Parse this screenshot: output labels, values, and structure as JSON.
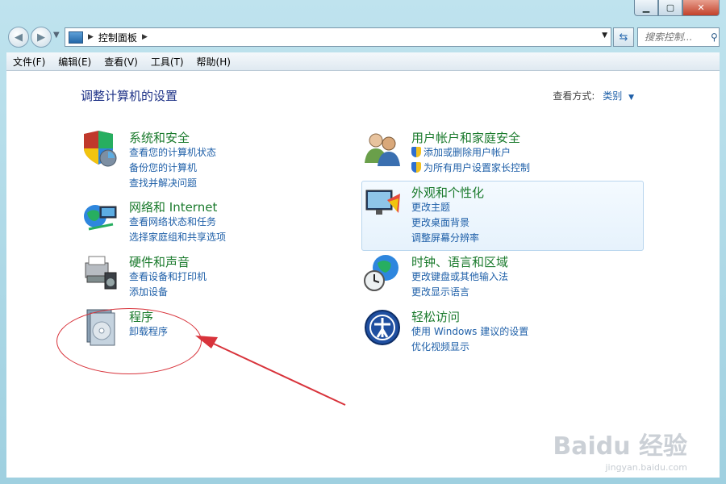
{
  "address": {
    "path": "控制面板"
  },
  "search": {
    "placeholder": "搜索控制..."
  },
  "menu": {
    "file": "文件(F)",
    "edit": "编辑(E)",
    "view": "查看(V)",
    "tools": "工具(T)",
    "help": "帮助(H)"
  },
  "page": {
    "title": "调整计算机的设置",
    "view_by_label": "查看方式:",
    "view_by_value": "类别"
  },
  "left": [
    {
      "title": "系统和安全",
      "links": [
        "查看您的计算机状态",
        "备份您的计算机",
        "查找并解决问题"
      ]
    },
    {
      "title": "网络和 Internet",
      "links": [
        "查看网络状态和任务",
        "选择家庭组和共享选项"
      ]
    },
    {
      "title": "硬件和声音",
      "links": [
        "查看设备和打印机",
        "添加设备"
      ]
    },
    {
      "title": "程序",
      "links": [
        "卸载程序"
      ]
    }
  ],
  "right": [
    {
      "title": "用户帐户和家庭安全",
      "links": [
        "添加或删除用户帐户",
        "为所有用户设置家长控制"
      ]
    },
    {
      "title": "外观和个性化",
      "links": [
        "更改主题",
        "更改桌面背景",
        "调整屏幕分辨率"
      ]
    },
    {
      "title": "时钟、语言和区域",
      "links": [
        "更改键盘或其他输入法",
        "更改显示语言"
      ]
    },
    {
      "title": "轻松访问",
      "links": [
        "使用 Windows 建议的设置",
        "优化视频显示"
      ]
    }
  ],
  "watermark": {
    "brand": "Baidu 经验",
    "url": "jingyan.baidu.com"
  },
  "colors": {
    "title_green": "#1a7a2c",
    "link_blue": "#1e5fa8",
    "annotation_red": "#d8333b"
  }
}
